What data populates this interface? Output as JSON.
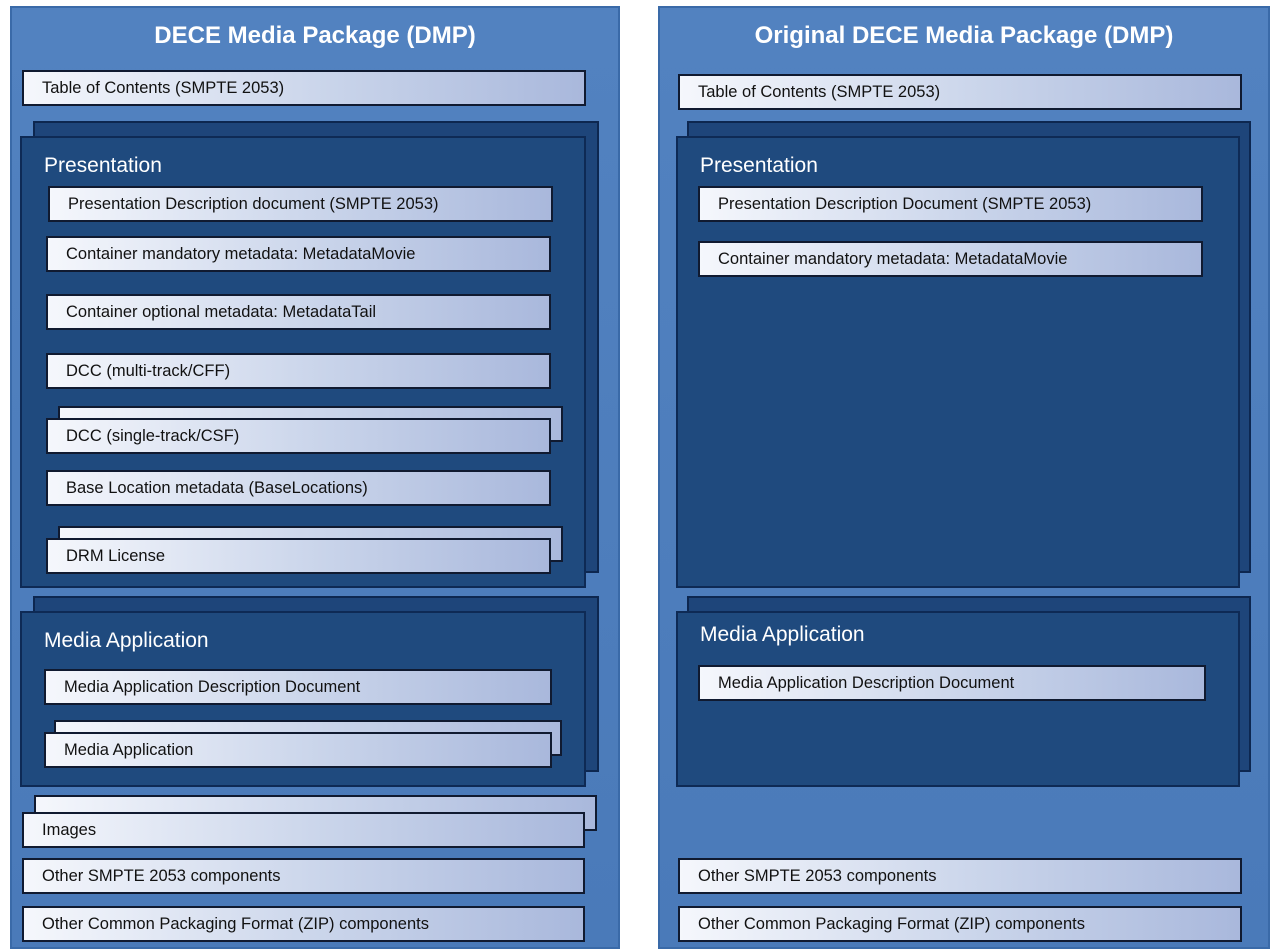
{
  "left": {
    "title": "DECE Media Package (DMP)",
    "toc": "Table of Contents (SMPTE 2053)",
    "presentation": {
      "title": "Presentation",
      "items": [
        "Presentation Description document (SMPTE 2053)",
        "Container mandatory metadata:  MetadataMovie",
        "Container optional metadata:  MetadataTail",
        "DCC (multi-track/CFF)",
        "DCC (single-track/CSF)",
        "Base Location metadata (BaseLocations)",
        "DRM License"
      ]
    },
    "media_application": {
      "title": "Media Application",
      "items": [
        "Media Application Description Document",
        "Media Application"
      ]
    },
    "images": "Images",
    "other_smpte": "Other SMPTE 2053 components",
    "other_zip": "Other Common Packaging Format (ZIP) components"
  },
  "right": {
    "title": "Original DECE Media Package (DMP)",
    "toc": "Table of Contents (SMPTE 2053)",
    "presentation": {
      "title": "Presentation",
      "items": [
        "Presentation Description Document (SMPTE 2053)",
        "Container mandatory metadata:  MetadataMovie"
      ]
    },
    "media_application": {
      "title": "Media Application",
      "items": [
        "Media Application Description Document"
      ]
    },
    "other_smpte": "Other SMPTE 2053 components",
    "other_zip": "Other Common Packaging Format (ZIP) components"
  }
}
